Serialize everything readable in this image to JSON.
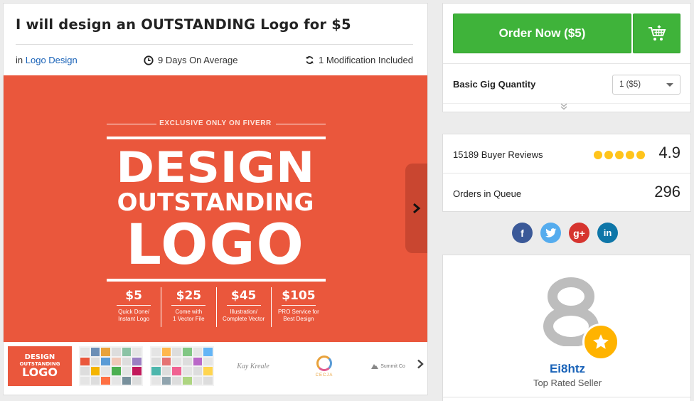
{
  "gig": {
    "title": "I will design an OUTSTANDING Logo for $5",
    "category_prefix": "in",
    "category": "Logo Design",
    "delivery": "9 Days On Average",
    "modifications": "1 Modification Included"
  },
  "hero": {
    "exclusive": "EXCLUSIVE ONLY ON FIVERR",
    "line1": "DESIGN",
    "line2": "OUTSTANDING",
    "line3": "LOGO",
    "packages": [
      {
        "price": "$5",
        "desc1": "Quick Done/",
        "desc2": "Instant Logo"
      },
      {
        "price": "$25",
        "desc1": "Come with",
        "desc2": "1 Vector File"
      },
      {
        "price": "$45",
        "desc1": "Illustration/",
        "desc2": "Complete Vector"
      },
      {
        "price": "$105",
        "desc1": "PRO Service for",
        "desc2": "Best Design"
      }
    ]
  },
  "thumbnails": {
    "t1": {
      "l1": "DESIGN",
      "l2": "OUTSTANDING",
      "l3": "LOGO"
    },
    "t4": "Kay Kreale",
    "t5": "CECJA",
    "t6": "Summit Co"
  },
  "order": {
    "button_label": "Order Now ($5)",
    "quantity_label": "Basic Gig Quantity",
    "quantity_value": "1 ($5)"
  },
  "stats": {
    "reviews_label": "15189 Buyer Reviews",
    "rating": "4.9",
    "rating_stars": 5,
    "queue_label": "Orders in Queue",
    "queue_value": "296"
  },
  "social": {
    "facebook": "f",
    "twitter": "t",
    "googleplus": "g+",
    "linkedin": "in"
  },
  "seller": {
    "name": "Ei8htz",
    "level": "Top Rated Seller"
  },
  "colors": {
    "hero_bg": "#ea573c",
    "order_green": "#3fb33a",
    "link_blue": "#1a63b8",
    "star_yellow": "#ffc41b"
  },
  "icons": [
    "clock-icon",
    "refresh-icon",
    "cart-icon",
    "chevron-right-icon",
    "chevron-down-icon",
    "star-icon",
    "facebook-icon",
    "twitter-icon",
    "googleplus-icon",
    "linkedin-icon"
  ]
}
